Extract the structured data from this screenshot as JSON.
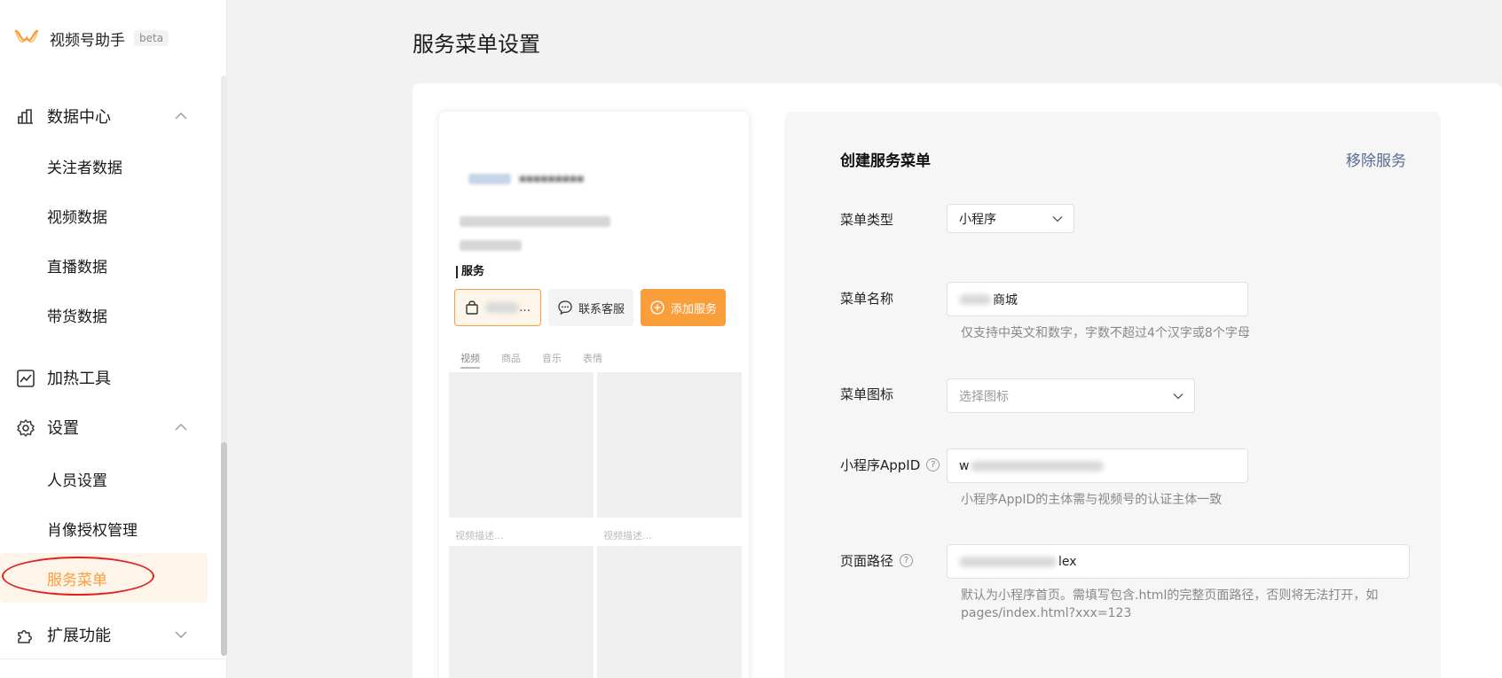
{
  "brand": {
    "name": "视频号助手",
    "badge": "beta",
    "accent": "#fa9d3b"
  },
  "sidebar": {
    "groups": [
      {
        "label": "数据中心",
        "icon": "bar-chart-icon",
        "expanded": true,
        "items": [
          "关注者数据",
          "视频数据",
          "直播数据",
          "带货数据"
        ]
      },
      {
        "label": "加热工具",
        "icon": "trend-chart-icon"
      },
      {
        "label": "设置",
        "icon": "gear-icon",
        "expanded": true,
        "items": [
          "人员设置",
          "肖像授权管理",
          "服务菜单"
        ]
      },
      {
        "label": "扩展功能",
        "icon": "puzzle-icon",
        "expanded": false
      }
    ],
    "active_item": "服务菜单",
    "annotation_color": "#e0231f"
  },
  "page": {
    "title": "服务菜单设置"
  },
  "preview": {
    "service_section_title": "服务",
    "buttons": {
      "shop_suffix": "…",
      "contact": "联系客服",
      "add": "添加服务"
    },
    "tabs": [
      "视频",
      "商品",
      "音乐",
      "表情"
    ],
    "grid_caption": "视频描述..."
  },
  "form": {
    "title": "创建服务菜单",
    "remove_label": "移除服务",
    "menu_type": {
      "label": "菜单类型",
      "value": "小程序"
    },
    "menu_name": {
      "label": "菜单名称",
      "value_visible": "商城",
      "hint": "仅支持中英文和数字，字数不超过4个汉字或8个字母"
    },
    "menu_icon": {
      "label": "菜单图标",
      "placeholder": "选择图标"
    },
    "appid": {
      "label": "小程序AppID",
      "value_visible": "w",
      "hint": "小程序AppID的主体需与视频号的认证主体一致"
    },
    "page_path": {
      "label": "页面路径",
      "value_visible": "lex",
      "hint_line1": "默认为小程序首页。需填写包含.html的完整页面路径，否则将无法打开，如",
      "hint_line2": "pages/index.html?xxx=123"
    }
  }
}
